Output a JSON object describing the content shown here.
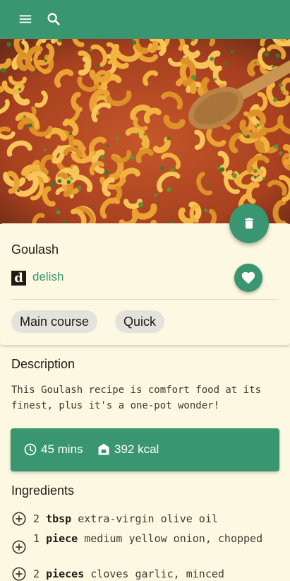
{
  "appbar": {
    "menu_icon": "menu-icon",
    "search_icon": "search-icon",
    "color": "#3a9670"
  },
  "recipe": {
    "image": "goulash-photo",
    "title": "Goulash",
    "source_logo": "d",
    "source_name": "delish",
    "tags": [
      "Main course",
      "Quick"
    ]
  },
  "description": {
    "heading": "Description",
    "text": "This Goulash recipe is comfort food at its finest, plus it's a one-pot wonder!"
  },
  "stats": {
    "time": "45 mins",
    "calories": "392 kcal"
  },
  "ingredients": {
    "heading": "Ingredients",
    "items": [
      {
        "qty": "2",
        "unit": "tbsp",
        "name": "extra-virgin olive oil"
      },
      {
        "qty": "1",
        "unit": "piece",
        "name": "medium yellow onion, chopped"
      },
      {
        "qty": "2",
        "unit": "pieces",
        "name": "cloves garlic, minced"
      }
    ]
  },
  "colors": {
    "primary": "#3a9670",
    "background": "#fdf8e1",
    "chip": "#e4e2dc"
  }
}
